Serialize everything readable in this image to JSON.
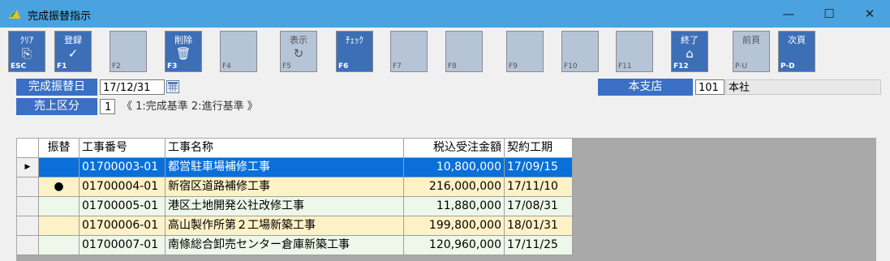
{
  "window": {
    "title": "完成振替指示",
    "minimize": "—",
    "maximize": "☐",
    "close": "✕"
  },
  "toolbar": [
    {
      "label": "ｸﾘｱ",
      "icon": "clear-icon",
      "key": "ESC",
      "enabled": true
    },
    {
      "label": "登録",
      "icon": "checkmark-icon",
      "key": "F1",
      "enabled": true
    },
    {
      "label": "",
      "icon": "",
      "key": "F2",
      "enabled": false
    },
    {
      "label": "削除",
      "icon": "trash-icon",
      "key": "F3",
      "enabled": true
    },
    {
      "label": "",
      "icon": "",
      "key": "F4",
      "enabled": false
    },
    {
      "label": "表示",
      "icon": "refresh-icon",
      "key": "F5",
      "enabled": false
    },
    {
      "label": "ﾁｪｯｸ",
      "icon": "",
      "key": "F6",
      "enabled": true
    },
    {
      "label": "",
      "icon": "",
      "key": "F7",
      "enabled": false
    },
    {
      "label": "",
      "icon": "",
      "key": "F8",
      "enabled": false
    },
    {
      "label": "",
      "icon": "",
      "key": "F9",
      "enabled": false
    },
    {
      "label": "",
      "icon": "",
      "key": "F10",
      "enabled": false
    },
    {
      "label": "",
      "icon": "",
      "key": "F11",
      "enabled": false
    },
    {
      "label": "終了",
      "icon": "home-icon",
      "key": "F12",
      "enabled": true
    },
    {
      "label": "前頁",
      "icon": "",
      "key": "P-U",
      "enabled": false
    },
    {
      "label": "次頁",
      "icon": "",
      "key": "P-D",
      "enabled": true
    }
  ],
  "form": {
    "transfer_date_label": "完成振替日",
    "transfer_date_value": "17/12/31",
    "sales_class_label": "売上区分",
    "sales_class_value": "1",
    "sales_class_hint": "《 1:完成基準 2:進行基準 》",
    "branch_label": "本支店",
    "branch_code": "101",
    "branch_name": "本社"
  },
  "grid": {
    "headers": [
      "振替",
      "工事番号",
      "工事名称",
      "税込受注金額",
      "契約工期"
    ],
    "rows": [
      {
        "transfer": "",
        "number": "01700003-01",
        "name": "都営駐車場補修工事",
        "amount": "10,800,000",
        "period": "17/09/15",
        "selected": true,
        "color": "yellow"
      },
      {
        "transfer": "●",
        "number": "01700004-01",
        "name": "新宿区道路補修工事",
        "amount": "216,000,000",
        "period": "17/11/10",
        "selected": false,
        "color": "yellow"
      },
      {
        "transfer": "",
        "number": "01700005-01",
        "name": "港区土地開発公社改修工事",
        "amount": "11,880,000",
        "period": "17/08/31",
        "selected": false,
        "color": "green"
      },
      {
        "transfer": "",
        "number": "01700006-01",
        "name": "高山製作所第２工場新築工事",
        "amount": "199,800,000",
        "period": "18/01/31",
        "selected": false,
        "color": "yellow"
      },
      {
        "transfer": "",
        "number": "01700007-01",
        "name": "南條総合卸売センター倉庫新築工事",
        "amount": "120,960,000",
        "period": "17/11/25",
        "selected": false,
        "color": "green"
      }
    ]
  }
}
